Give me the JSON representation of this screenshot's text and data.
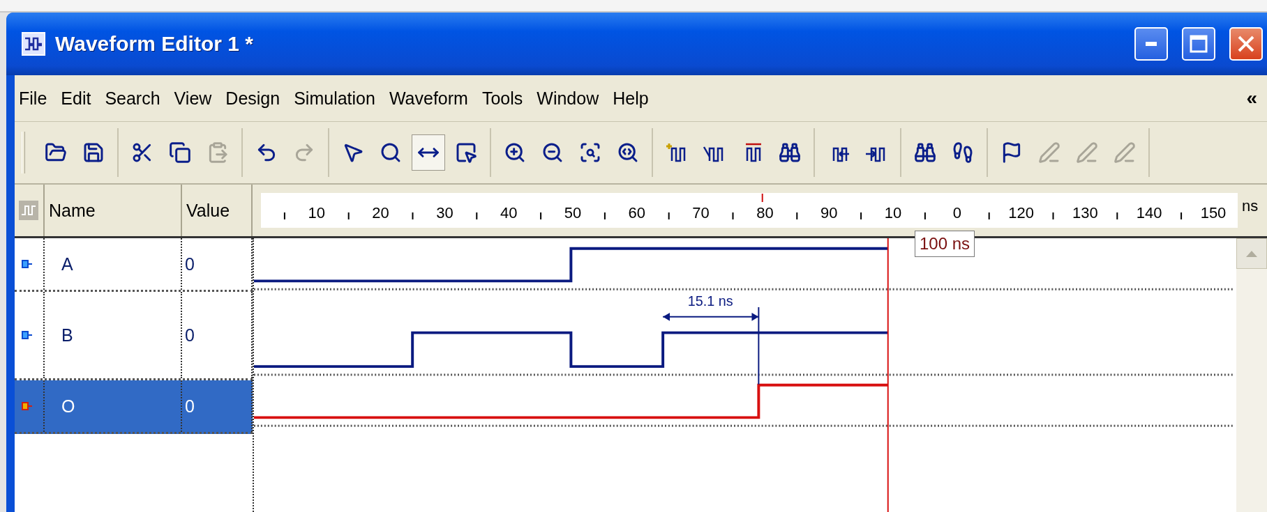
{
  "window": {
    "title": "Waveform Editor 1 *"
  },
  "menu": {
    "items": [
      "File",
      "Edit",
      "Search",
      "View",
      "Design",
      "Simulation",
      "Waveform",
      "Tools",
      "Window",
      "Help"
    ],
    "chevron": "«"
  },
  "toolbar": {
    "groups": [
      [
        {
          "disabled": false,
          "pressed": false
        },
        {
          "disabled": false,
          "pressed": false
        }
      ],
      [
        {
          "disabled": false,
          "pressed": false
        },
        {
          "disabled": false,
          "pressed": false
        },
        {
          "disabled": true,
          "pressed": false
        }
      ],
      [
        {
          "disabled": false,
          "pressed": false
        },
        {
          "disabled": true,
          "pressed": false
        }
      ],
      [
        {
          "disabled": false,
          "pressed": false
        },
        {
          "disabled": false,
          "pressed": false
        },
        {
          "disabled": false,
          "pressed": true
        },
        {
          "disabled": false,
          "pressed": false
        }
      ],
      [
        {
          "disabled": false,
          "pressed": false
        },
        {
          "disabled": false,
          "pressed": false
        },
        {
          "disabled": false,
          "pressed": false
        },
        {
          "disabled": false,
          "pressed": false
        }
      ],
      [
        {
          "disabled": false,
          "pressed": false
        },
        {
          "disabled": false,
          "pressed": false
        },
        {
          "disabled": false,
          "pressed": false
        },
        {
          "disabled": false,
          "pressed": false
        }
      ],
      [
        {
          "disabled": false,
          "pressed": false
        },
        {
          "disabled": false,
          "pressed": false
        }
      ],
      [
        {
          "disabled": false,
          "pressed": false
        },
        {
          "disabled": false,
          "pressed": false
        }
      ],
      [
        {
          "disabled": false,
          "pressed": false
        },
        {
          "disabled": true,
          "pressed": false
        },
        {
          "disabled": true,
          "pressed": false
        },
        {
          "disabled": true,
          "pressed": false
        }
      ]
    ]
  },
  "columns": {
    "name": "Name",
    "value": "Value"
  },
  "ruler": {
    "labels": [
      "10",
      "20",
      "30",
      "40",
      "50",
      "60",
      "70",
      "80",
      "90",
      "10",
      "0",
      "120",
      "130",
      "140",
      "150"
    ],
    "unit": "ns"
  },
  "signals": [
    {
      "name": "A",
      "value": "0",
      "kind": "input",
      "selected": false
    },
    {
      "name": "B",
      "value": "0",
      "kind": "input",
      "selected": false
    },
    {
      "name": "O",
      "value": "0",
      "kind": "output",
      "selected": true
    }
  ],
  "measurement": {
    "label": "15.1 ns"
  },
  "cursor": {
    "label": "100 ns"
  }
}
